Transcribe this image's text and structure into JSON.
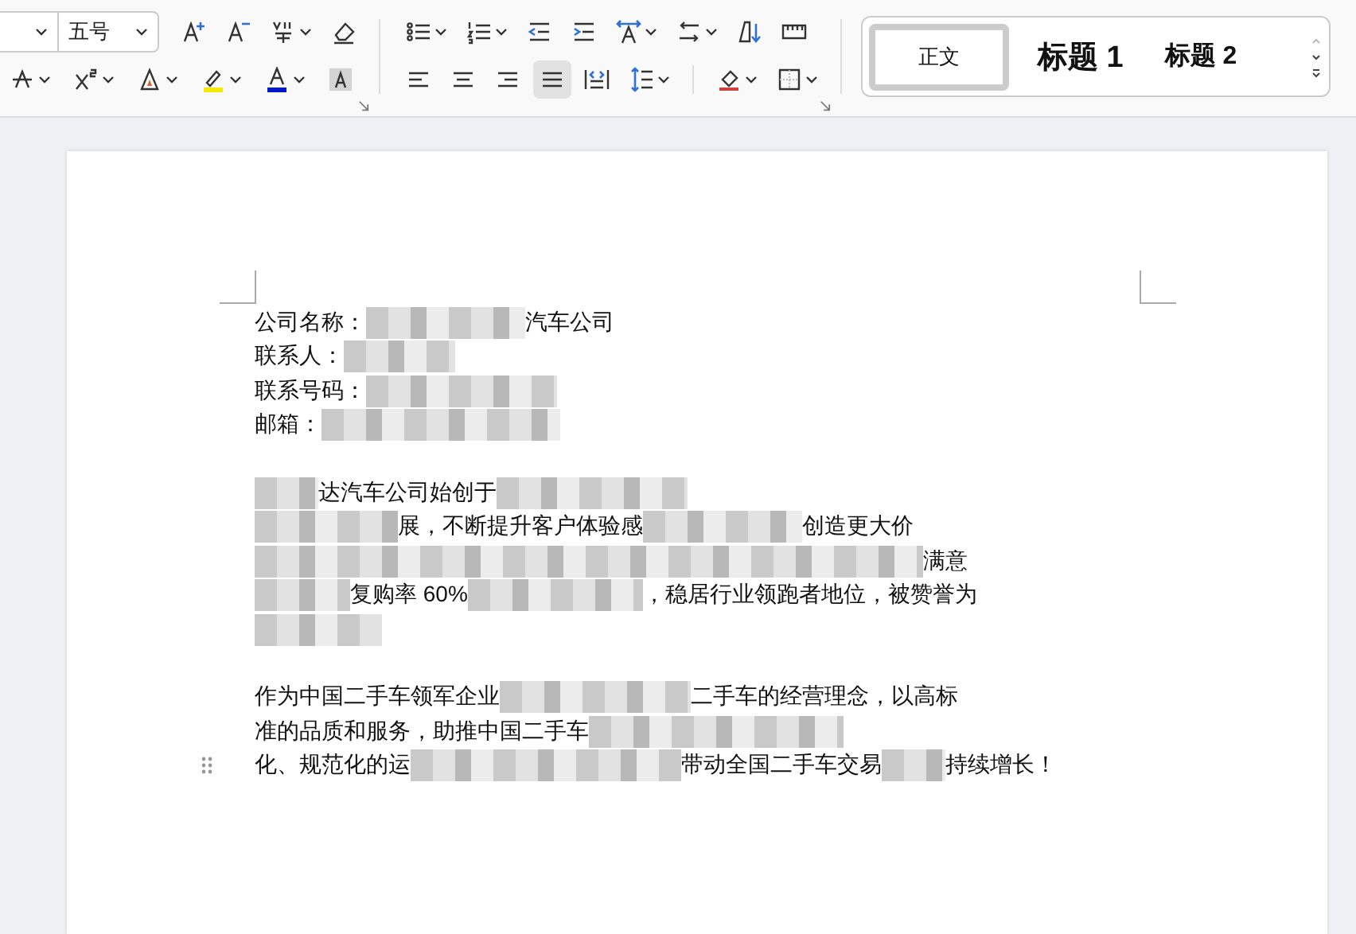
{
  "ribbon": {
    "font_group": {
      "font_name": {
        "dropdown": true
      },
      "font_size": {
        "value": "五号",
        "dropdown": true
      },
      "row_1": [
        {
          "kind": "grow",
          "dropdown": false
        },
        {
          "kind": "shrink",
          "dropdown": false
        },
        {
          "kind": "phonetic",
          "dropdown": true
        },
        {
          "kind": "eraser",
          "dropdown": false
        }
      ],
      "row_2": [
        {
          "kind": "strike",
          "dropdown": true
        },
        {
          "kind": "superscript",
          "dropdown": true
        },
        {
          "kind": "effect",
          "dropdown": true
        },
        {
          "kind": "highlight",
          "dropdown": true
        },
        {
          "kind": "fontcolor",
          "dropdown": true
        },
        {
          "kind": "shade",
          "dropdown": false
        }
      ]
    },
    "paragraph_group": {
      "row_1": [
        {
          "kind": "bullets",
          "dropdown": true
        },
        {
          "kind": "numbering",
          "dropdown": true
        },
        {
          "kind": "outdent",
          "dropdown": false
        },
        {
          "kind": "indent",
          "dropdown": false
        },
        {
          "kind": "direction",
          "dropdown": true
        },
        {
          "kind": "swap",
          "dropdown": true
        },
        {
          "kind": "sort",
          "dropdown": false
        },
        {
          "kind": "ruler",
          "dropdown": false
        }
      ],
      "alignment": [
        {
          "kind": "left",
          "selected": false
        },
        {
          "kind": "center",
          "selected": false
        },
        {
          "kind": "right",
          "selected": false
        },
        {
          "kind": "justify",
          "selected": true
        },
        {
          "kind": "distributed",
          "selected": false
        }
      ],
      "row_2": [
        {
          "kind": "spacing",
          "dropdown": true
        },
        {
          "kind": "fill",
          "dropdown": true
        },
        {
          "kind": "border",
          "dropdown": true
        }
      ]
    },
    "styles": [
      {
        "label": "正文",
        "kind": "normal",
        "selected": true
      },
      {
        "label": "标题 1",
        "kind": "h1",
        "selected": false
      },
      {
        "label": "标题 2",
        "kind": "h2",
        "selected": false
      }
    ]
  },
  "document": {
    "paragraphs": [
      [
        [
          {
            "kind": "text",
            "text": "公司名称："
          },
          {
            "kind": "redacted"
          },
          {
            "kind": "text",
            "text": "汽车公司"
          }
        ],
        [
          {
            "kind": "text",
            "text": "联系人："
          },
          {
            "kind": "redacted"
          }
        ],
        [
          {
            "kind": "text",
            "text": "联系号码："
          },
          {
            "kind": "redacted"
          }
        ],
        [
          {
            "kind": "text",
            "text": "邮箱："
          },
          {
            "kind": "redacted"
          }
        ]
      ],
      [
        [
          {
            "kind": "redacted"
          },
          {
            "kind": "text",
            "text": "达汽车公司始创于"
          },
          {
            "kind": "redacted"
          }
        ],
        [
          {
            "kind": "redacted"
          },
          {
            "kind": "text",
            "text": "展，不断提升客户体验感"
          },
          {
            "kind": "redacted"
          },
          {
            "kind": "text",
            "text": "创造更大价"
          }
        ],
        [
          {
            "kind": "redacted"
          },
          {
            "kind": "text",
            "text": "满意"
          }
        ],
        [
          {
            "kind": "redacted"
          },
          {
            "kind": "text",
            "text": "复购率 60%"
          },
          {
            "kind": "redacted"
          },
          {
            "kind": "text",
            "text": "，稳居行业领跑者地位，被赞誉为"
          }
        ],
        [
          {
            "kind": "redacted"
          }
        ]
      ],
      [
        [
          {
            "kind": "text",
            "text": "作为中国二手车领军企业"
          },
          {
            "kind": "redacted"
          },
          {
            "kind": "text",
            "text": "二手车的经营理念，以高标"
          }
        ],
        [
          {
            "kind": "text",
            "text": "准的品质和服务，助推中国二手车"
          },
          {
            "kind": "redacted"
          }
        ],
        [
          {
            "kind": "text",
            "text": "化、规范化的运"
          },
          {
            "kind": "redacted"
          },
          {
            "kind": "text",
            "text": "带动全国二手车交易"
          },
          {
            "kind": "redacted"
          },
          {
            "kind": "text",
            "text": "持续增长！"
          }
        ]
      ]
    ]
  }
}
